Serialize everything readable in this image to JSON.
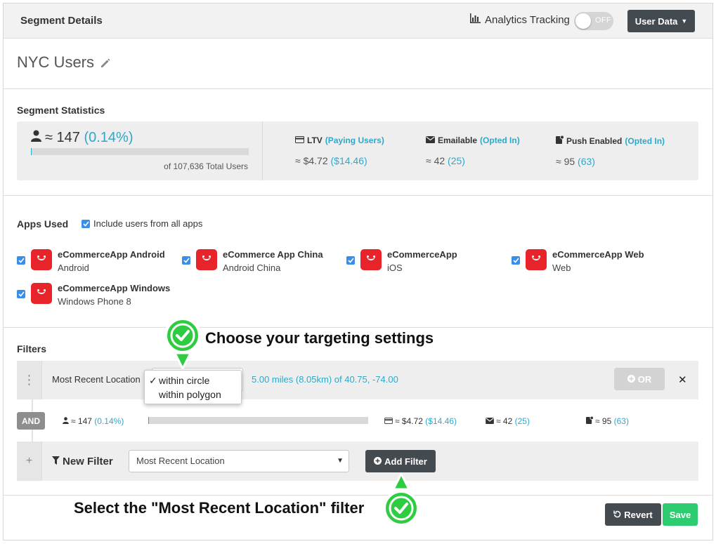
{
  "header": {
    "title": "Segment Details",
    "analytics_label": "Analytics Tracking",
    "toggle_state": "OFF",
    "user_data_label": "User Data"
  },
  "segment": {
    "name": "NYC Users"
  },
  "statistics": {
    "title": "Segment Statistics",
    "users_approx": "≈ 147",
    "users_pct": "(0.14%)",
    "users_fraction": 0.0014,
    "total_users": "of 107,636 Total Users",
    "ltv_label": "LTV",
    "ltv_sub": "(Paying Users)",
    "ltv_value": "≈ $4.72",
    "ltv_paying": "($14.46)",
    "email_label": "Emailable",
    "email_sub": "(Opted In)",
    "email_value": "≈ 42",
    "email_opted": "(25)",
    "push_label": "Push Enabled",
    "push_sub": "(Opted In)",
    "push_value": "≈ 95",
    "push_opted": "(63)"
  },
  "apps": {
    "title": "Apps Used",
    "include_all_label": "Include users from all apps",
    "items": [
      {
        "name": "eCommerceApp Android",
        "platform": "Android"
      },
      {
        "name": "eCommerce App China",
        "platform": "Android China"
      },
      {
        "name": "eCommerceApp",
        "platform": "iOS"
      },
      {
        "name": "eCommerceApp Web",
        "platform": "Web"
      },
      {
        "name": "eCommerceApp Windows",
        "platform": "Windows Phone 8"
      }
    ]
  },
  "filters": {
    "title": "Filters",
    "filter_name": "Most Recent Location",
    "dropdown_options": [
      "within circle",
      "within polygon"
    ],
    "dropdown_selected": "within circle",
    "filter_desc": "5.00 miles (8.05km) of 40.75, -74.00",
    "or_label": "OR",
    "and_label": "AND",
    "mini": {
      "users": "≈ 147",
      "users_pct": "(0.14%)",
      "ltv": "≈ $4.72",
      "ltv_paying": "($14.46)",
      "email": "≈ 42",
      "email_opted": "(25)",
      "push": "≈ 95",
      "push_opted": "(63)"
    },
    "new_filter_label": "New Filter",
    "new_filter_select": "Most Recent Location",
    "add_filter_label": "Add Filter"
  },
  "footer": {
    "revert_label": "Revert",
    "save_label": "Save"
  },
  "annotations": {
    "top": "Choose your targeting settings",
    "bottom": "Select the \"Most Recent Location\" filter"
  },
  "colors": {
    "accent": "#2ea8c9",
    "dark_button": "#434a50",
    "save_green": "#2ecc71",
    "app_red": "#e8232a",
    "annotation_green": "#2ecc40"
  }
}
